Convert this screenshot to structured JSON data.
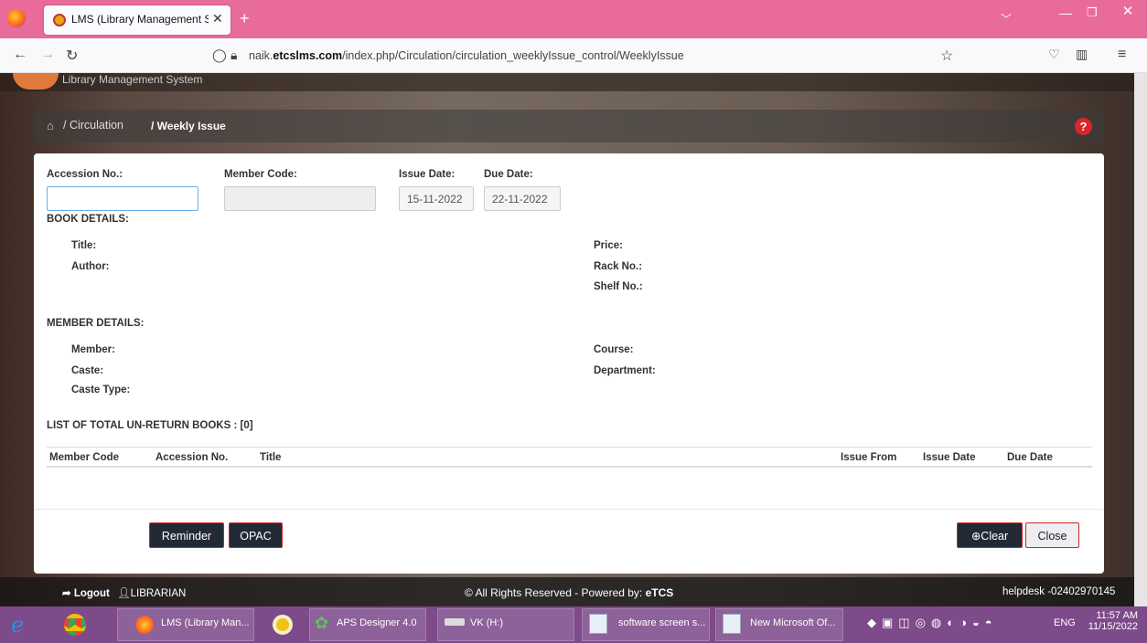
{
  "browser": {
    "tab_title": "LMS (Library Management Syst",
    "url_prefix": "naik.",
    "url_domain": "etcslms.com",
    "url_path": "/index.php/Circulation/circulation_weeklyIssue_control/WeeklyIssue"
  },
  "header": {
    "logo_text": "Library Management System"
  },
  "breadcrumb": {
    "section": "/ Circulation",
    "current": "/ Weekly Issue"
  },
  "form": {
    "accession_label": "Accession No.:",
    "accession_value": "",
    "member_code_label": "Member Code:",
    "issue_date_label": "Issue Date:",
    "issue_date_value": "15-11-2022",
    "due_date_label": "Due Date:",
    "due_date_value": "22-11-2022"
  },
  "book_details": {
    "heading": "BOOK DETAILS:",
    "title_label": "Title:",
    "author_label": "Author:",
    "price_label": "Price:",
    "rack_label": "Rack No.:",
    "shelf_label": "Shelf No.:"
  },
  "member_details": {
    "heading": "MEMBER DETAILS:",
    "member_label": "Member:",
    "caste_label": "Caste:",
    "caste_type_label": "Caste Type:",
    "course_label": "Course:",
    "department_label": "Department:"
  },
  "unreturned": {
    "heading": "LIST OF TOTAL UN-RETURN BOOKS :",
    "count": "[0]",
    "columns": [
      "Member Code",
      "Accession No.",
      "Title",
      "Issue From",
      "Issue Date",
      "Due Date"
    ]
  },
  "buttons": {
    "reminder": "Reminder",
    "opac": "OPAC",
    "clear": "Clear",
    "close": "Close"
  },
  "footer": {
    "logout": "Logout",
    "user": "LIBRARIAN",
    "copyright": "© All Rights Reserved - Powered by:",
    "brand": "eTCS",
    "helpdesk": "helpdesk -02402970145"
  },
  "taskbar": {
    "items": [
      "LMS (Library Man...",
      "APS Designer 4.0",
      "VK (H:)",
      "software screen s...",
      "New Microsoft Of..."
    ],
    "lang": "ENG",
    "time": "11:57 AM",
    "date": "11/15/2022"
  }
}
